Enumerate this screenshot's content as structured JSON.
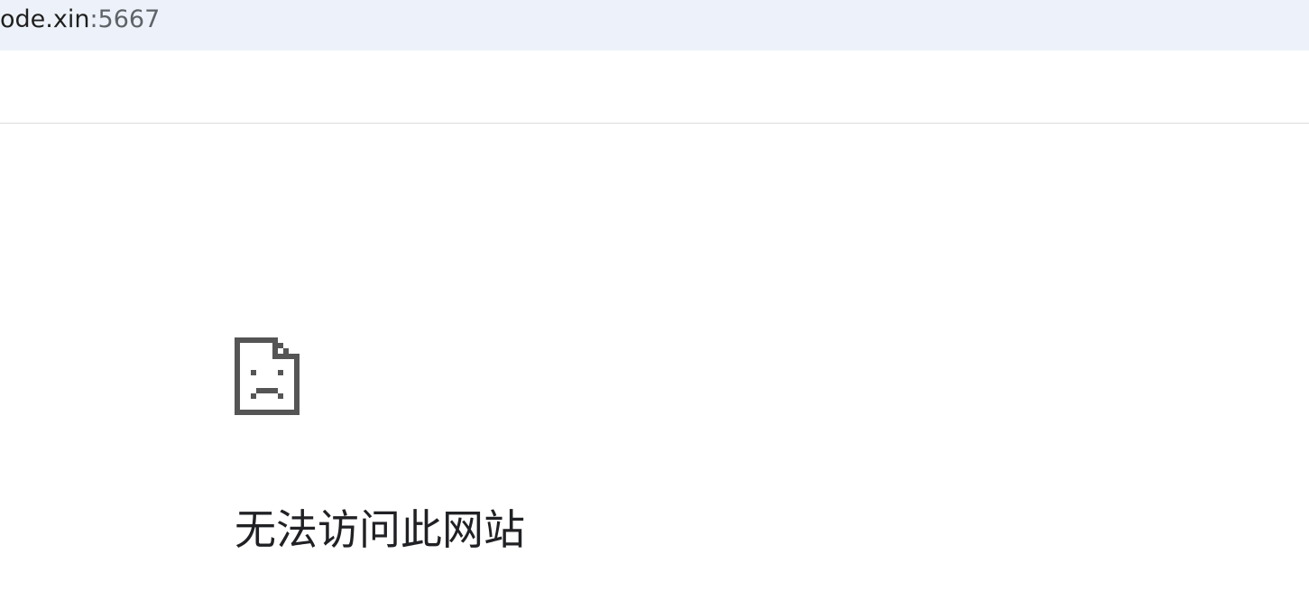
{
  "address_bar": {
    "url_host": "ode.xin",
    "url_port": ":5667"
  },
  "error_page": {
    "icon": "sad-file-icon",
    "title": "无法访问此网站",
    "subtext": ""
  },
  "colors": {
    "address_bar_bg": "#edf2fa",
    "icon": "#555555",
    "title": "#202124"
  }
}
